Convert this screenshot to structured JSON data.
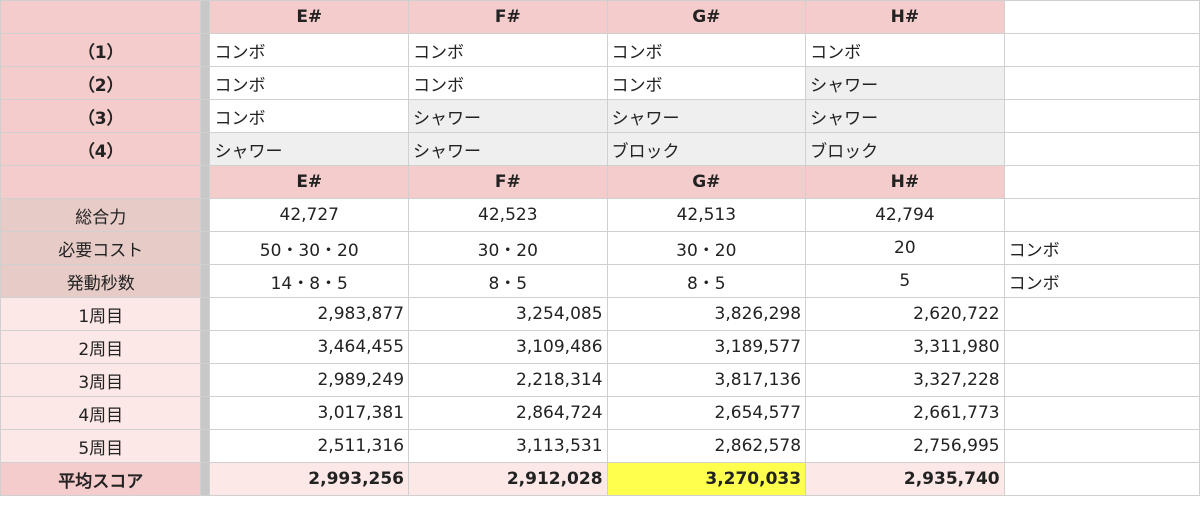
{
  "columns": [
    "E#",
    "F#",
    "G#",
    "H#"
  ],
  "skill_rows": [
    {
      "label": "（1）",
      "values": [
        "コンボ",
        "コンボ",
        "コンボ",
        "コンボ"
      ],
      "highlight": [
        false,
        false,
        false,
        false
      ]
    },
    {
      "label": "（2）",
      "values": [
        "コンボ",
        "コンボ",
        "コンボ",
        "シャワー"
      ],
      "highlight": [
        false,
        false,
        false,
        true
      ]
    },
    {
      "label": "（3）",
      "values": [
        "コンボ",
        "シャワー",
        "シャワー",
        "シャワー"
      ],
      "highlight": [
        false,
        true,
        true,
        true
      ]
    },
    {
      "label": "（4）",
      "values": [
        "シャワー",
        "シャワー",
        "ブロック",
        "ブロック"
      ],
      "highlight": [
        true,
        true,
        true,
        true
      ]
    }
  ],
  "stats": [
    {
      "label": "総合力",
      "values": [
        "42,727",
        "42,523",
        "42,513",
        "42,794"
      ],
      "extra": ""
    },
    {
      "label": "必要コスト",
      "values": [
        "50・30・20",
        "30・20",
        "30・20",
        "20"
      ],
      "extra": "コンボ"
    },
    {
      "label": "発動秒数",
      "values": [
        "14・8・5",
        "8・5",
        "8・5",
        "5"
      ],
      "extra": "コンボ"
    }
  ],
  "rounds": [
    {
      "label": "1周目",
      "values": [
        "2,983,877",
        "3,254,085",
        "3,826,298",
        "2,620,722"
      ]
    },
    {
      "label": "2周目",
      "values": [
        "3,464,455",
        "3,109,486",
        "3,189,577",
        "3,311,980"
      ]
    },
    {
      "label": "3周目",
      "values": [
        "2,989,249",
        "2,218,314",
        "3,817,136",
        "3,327,228"
      ]
    },
    {
      "label": "4周目",
      "values": [
        "3,017,381",
        "2,864,724",
        "2,654,577",
        "2,661,773"
      ]
    },
    {
      "label": "5周目",
      "values": [
        "2,511,316",
        "3,113,531",
        "2,862,578",
        "2,756,995"
      ]
    }
  ],
  "average": {
    "label": "平均スコア",
    "values": [
      "2,993,256",
      "2,912,028",
      "3,270,033",
      "2,935,740"
    ],
    "best_index": 2
  },
  "colors": {
    "header_pink": "#f4cccc",
    "label_tan": "#e6cbc7",
    "label_light": "#fce8e6",
    "option_gray": "#efefef",
    "best_yellow": "#ffff4d"
  }
}
